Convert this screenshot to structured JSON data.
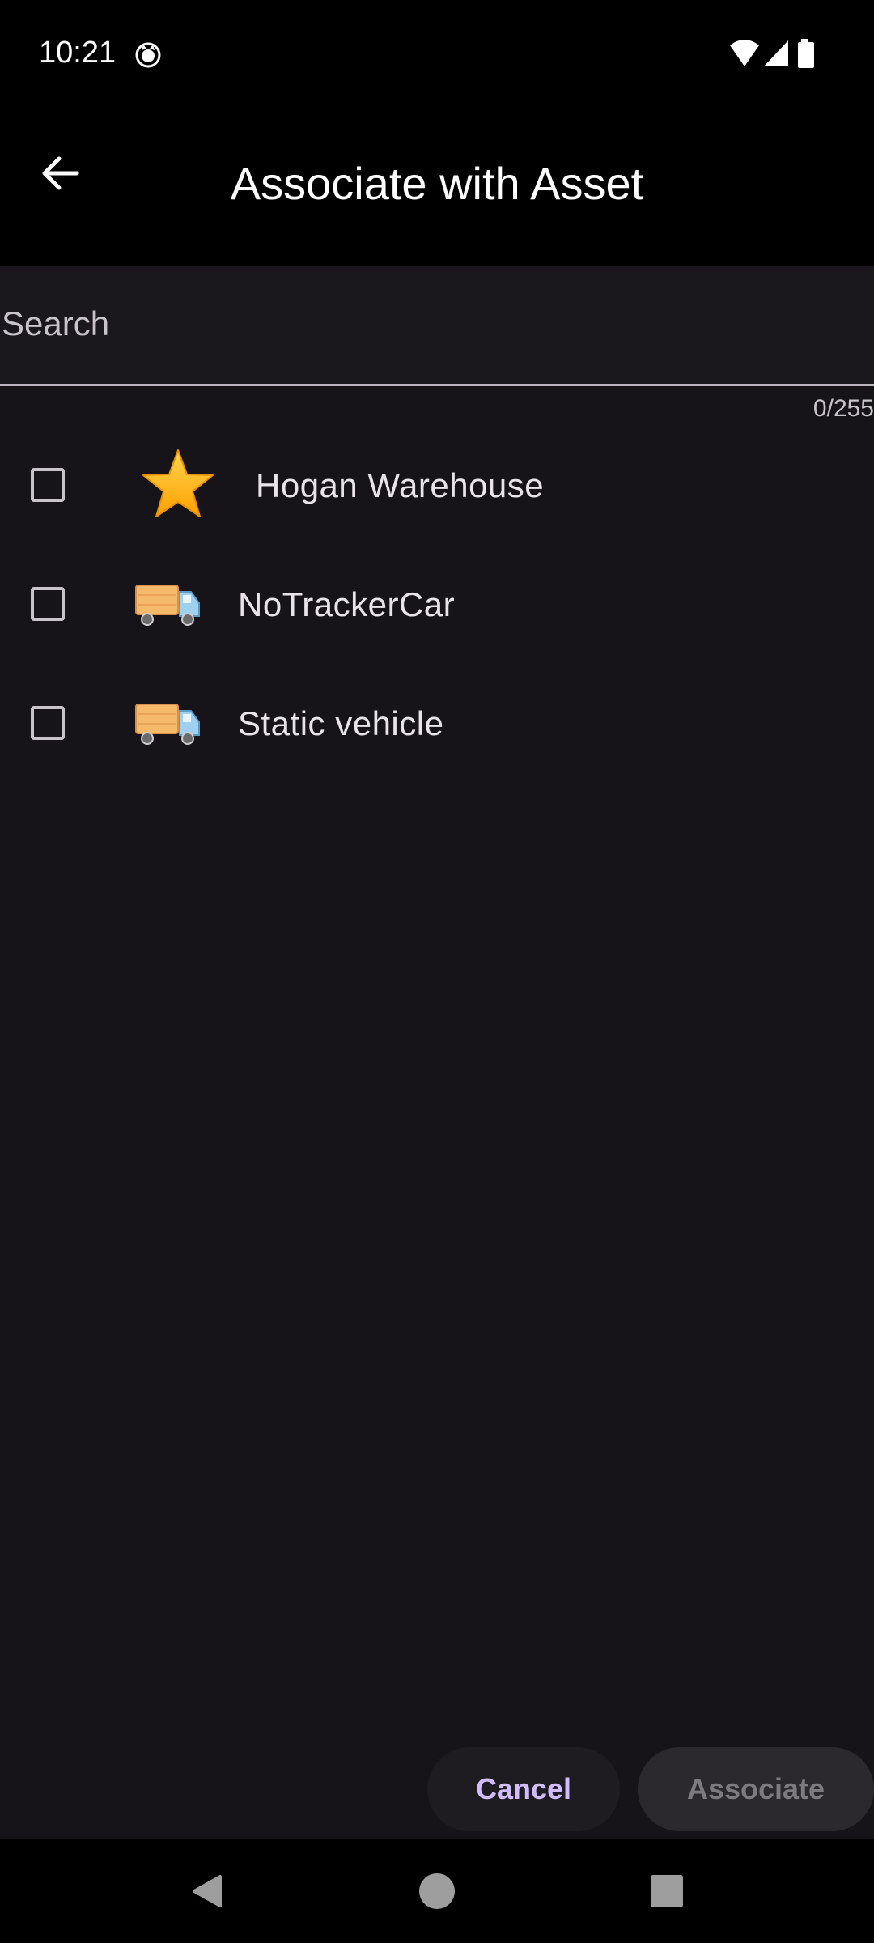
{
  "status_bar": {
    "time": "10:21"
  },
  "app_bar": {
    "title": "Associate with Asset"
  },
  "search": {
    "placeholder": "Search",
    "value": "",
    "counter": "0/255"
  },
  "assets": [
    {
      "label": "Hogan Warehouse",
      "icon": "star-icon",
      "checked": false
    },
    {
      "label": "NoTrackerCar",
      "icon": "truck-icon",
      "checked": false
    },
    {
      "label": "Static vehicle",
      "icon": "truck-icon",
      "checked": false
    }
  ],
  "actions": {
    "cancel_label": "Cancel",
    "associate_label": "Associate"
  },
  "colors": {
    "accent": "#d0bcff",
    "background": "#161419",
    "star": "#ffc107",
    "truck_cargo": "#f5b96a",
    "truck_cab": "#9fd0f0"
  }
}
